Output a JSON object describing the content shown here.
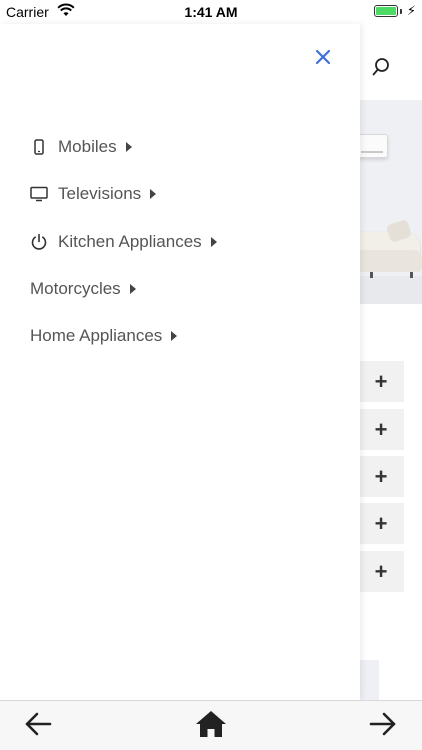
{
  "status_bar": {
    "carrier": "Carrier",
    "time": "1:41 AM",
    "wifi_icon": "wifi-icon",
    "battery_icon": "battery-icon",
    "battery_level": 1.0
  },
  "drawer": {
    "close_icon": "close-icon",
    "close_color": "#3f6fd8",
    "menu": [
      {
        "label": "Mobiles",
        "icon": "mobile-phone-icon"
      },
      {
        "label": "Televisions",
        "icon": "television-icon"
      },
      {
        "label": "Kitchen Appliances",
        "icon": "power-icon"
      },
      {
        "label": "Motorcycles",
        "icon": null
      },
      {
        "label": "Home Appliances",
        "icon": null
      }
    ]
  },
  "background": {
    "search_icon": "search-icon",
    "add_buttons": [
      "+",
      "+",
      "+",
      "+",
      "+"
    ]
  },
  "bottom_nav": {
    "back_icon": "arrow-left-icon",
    "home_icon": "home-icon",
    "forward_icon": "arrow-right-icon"
  }
}
